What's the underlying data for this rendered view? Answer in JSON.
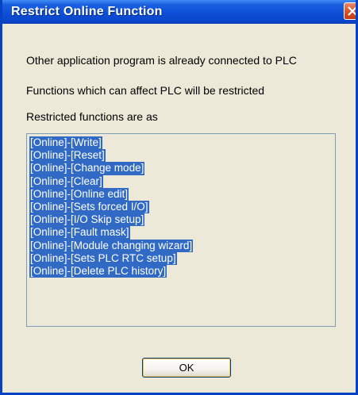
{
  "window": {
    "title": "Restrict Online Function",
    "close_icon": "close-icon"
  },
  "messages": [
    "Other application program is already connected to PLC",
    "Functions which can affect PLC will be restricted",
    "Restricted functions are as"
  ],
  "restricted_functions": [
    "[Online]-[Write]",
    "[Online]-[Reset]",
    "[Online]-[Change mode]",
    "[Online]-[Clear]",
    "[Online]-[Online edit]",
    "[Online]-[Sets forced I/O]",
    "[Online]-[I/O Skip setup]",
    "[Online]-[Fault mask]",
    "[Online]-[Module changing wizard]",
    "[Online]-[Sets PLC RTC setup]",
    "[Online]-[Delete PLC history]"
  ],
  "buttons": {
    "ok_label": "OK"
  },
  "colors": {
    "title_bar": "#0a46cc",
    "selection": "#316ac5",
    "dialog_bg": "#ece9d8"
  }
}
